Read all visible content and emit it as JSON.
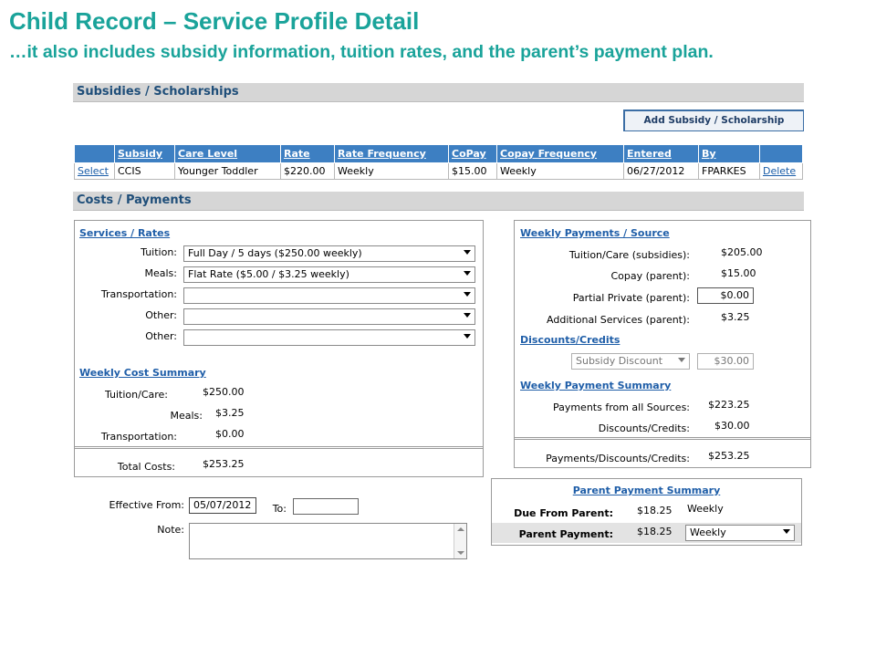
{
  "slide": {
    "title": "Child Record – Service Profile Detail",
    "subtitle": "…it also includes subsidy information, tuition rates, and the parent’s payment plan."
  },
  "subsidies": {
    "section_title": "Subsidies / Scholarships",
    "add_button": "Add Subsidy / Scholarship",
    "columns": [
      "Subsidy",
      "Care Level",
      "Rate",
      "Rate Frequency",
      "CoPay",
      "Copay Frequency",
      "Entered",
      "By"
    ],
    "row": {
      "select": "Select",
      "subsidy": "CCIS",
      "care_level": "Younger Toddler",
      "rate": "$220.00",
      "rate_frequency": "Weekly",
      "copay": "$15.00",
      "copay_frequency": "Weekly",
      "entered": "06/27/2012",
      "by": "FPARKES",
      "delete": "Delete"
    }
  },
  "costs": {
    "section_title": "Costs / Payments",
    "services": {
      "heading": "Services / Rates",
      "tuition_label": "Tuition:",
      "tuition_value": "Full Day / 5 days ($250.00 weekly)",
      "meals_label": "Meals:",
      "meals_value": "Flat Rate ($5.00 / $3.25 weekly)",
      "transportation_label": "Transportation:",
      "transportation_value": "",
      "other1_label": "Other:",
      "other1_value": "",
      "other2_label": "Other:",
      "other2_value": ""
    },
    "weekly_cost": {
      "heading": "Weekly Cost Summary",
      "tuition_label": "Tuition/Care:",
      "tuition_value": "$250.00",
      "meals_label": "Meals:",
      "meals_value": "$3.25",
      "transportation_label": "Transportation:",
      "transportation_value": "$0.00",
      "total_label": "Total Costs:",
      "total_value": "$253.25"
    },
    "weekly_payments": {
      "heading": "Weekly Payments / Source",
      "tuition_label": "Tuition/Care (subsidies):",
      "tuition_value": "$205.00",
      "copay_label": "Copay (parent):",
      "copay_value": "$15.00",
      "partial_label": "Partial Private (parent):",
      "partial_value": "$0.00",
      "additional_label": "Additional Services (parent):",
      "additional_value": "$3.25"
    },
    "discounts": {
      "heading": "Discounts/Credits",
      "select_value": "Subsidy Discount",
      "amount": "$30.00"
    },
    "payment_summary": {
      "heading": "Weekly Payment Summary",
      "all_sources_label": "Payments from all Sources:",
      "all_sources_value": "$223.25",
      "discounts_label": "Discounts/Credits:",
      "discounts_value": "$30.00",
      "total_label": "Payments/Discounts/Credits:",
      "total_value": "$253.25"
    },
    "parent_summary": {
      "heading": "Parent Payment Summary",
      "due_label": "Due From Parent:",
      "due_value": "$18.25",
      "due_freq": "Weekly",
      "payment_label": "Parent Payment:",
      "payment_value": "$18.25",
      "payment_freq": "Weekly"
    },
    "effective": {
      "from_label": "Effective From:",
      "from_value": "05/07/2012",
      "to_label": "To:",
      "to_value": "",
      "note_label": "Note:",
      "note_value": ""
    }
  }
}
